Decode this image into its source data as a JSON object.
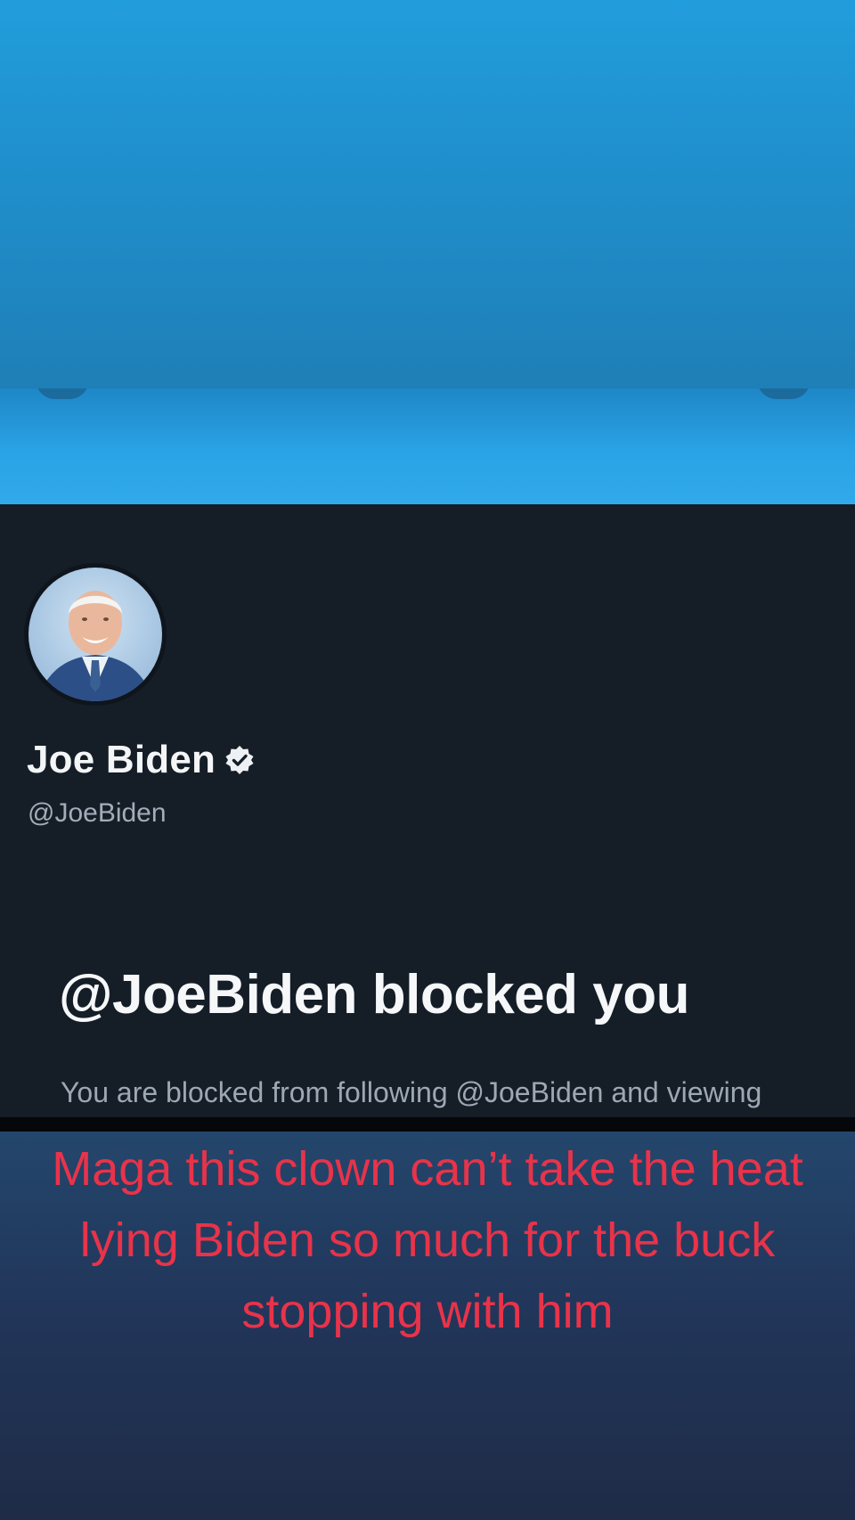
{
  "profile": {
    "name": "Joe Biden",
    "handle": "@JoeBiden",
    "verified": true
  },
  "blocked_notice": {
    "title": "@JoeBiden blocked you",
    "description": "You are blocked from following @JoeBiden and viewing @JoeBiden’s Tweets."
  },
  "caption": {
    "text": "Maga this clown can’t take the heat lying Biden so much for the buck stopping with him",
    "color": "#e8334a"
  },
  "icons": {
    "verified": "verified-badge-icon"
  },
  "colors": {
    "top_background": "#229ddc",
    "screenshot_background": "#151d27",
    "banner": "#2aa3e6",
    "bottom_background": "#1f2b47"
  }
}
